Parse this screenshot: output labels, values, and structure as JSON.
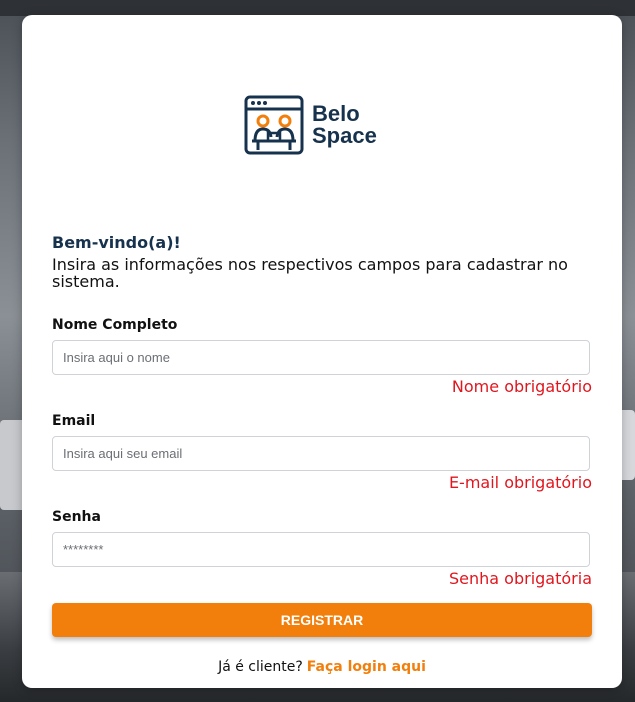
{
  "brand": {
    "line1": "Belo",
    "line2": "Space"
  },
  "welcome": "Bem-vindo(a)!",
  "intro": "Insira as informações nos respectivos campos para cadastrar no sistema.",
  "form": {
    "name": {
      "label": "Nome Completo",
      "placeholder": "Insira aqui o nome",
      "error": "Nome obrigatório"
    },
    "email": {
      "label": "Email",
      "placeholder": "Insira aqui seu email",
      "error": "E-mail obrigatório"
    },
    "password": {
      "label": "Senha",
      "placeholder": "********",
      "error": "Senha obrigatória"
    },
    "submit_label": "REGISTRAR"
  },
  "footer": {
    "prompt": "Já é cliente?",
    "link_label": "Faça login aqui"
  },
  "colors": {
    "accent": "#f27f0c",
    "brand_dark": "#17324d",
    "error": "#e0161e"
  }
}
